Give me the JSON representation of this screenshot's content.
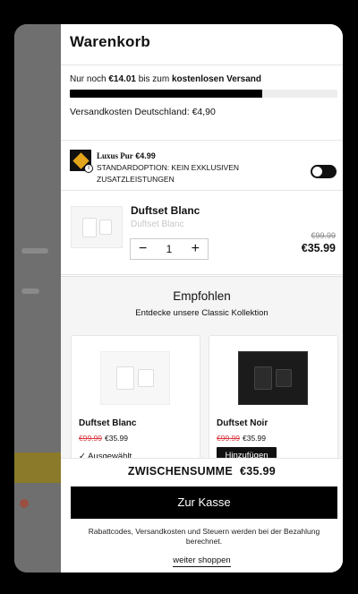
{
  "cart": {
    "title": "Warenkorb"
  },
  "shipping": {
    "prefix": "Nur noch ",
    "remaining": "€14.01",
    "middle": " bis zum ",
    "goal": "kostenlosen Versand",
    "progress": 0.72,
    "cost_label": "Versandkosten Deutschland: €4,90"
  },
  "addon": {
    "brand": "Luxus Pur",
    "price": "€4.99",
    "description": "STANDARDOPTION: KEIN EXKLUSIVEN ZUSATZLEISTUNGEN",
    "toggle_on": false
  },
  "item": {
    "name": "Duftset Blanc",
    "variant": "Duftset Blanc",
    "quantity": "1",
    "minus": "−",
    "plus": "+",
    "old_price": "€99.99",
    "price": "€35.99"
  },
  "recommended": {
    "title": "Empfohlen",
    "subtitle": "Entdecke unsere Classic Kollektion",
    "products": [
      {
        "name": "Duftset Blanc",
        "old_price": "€99.99",
        "price": "€35.99",
        "status": "✓ Ausgewählt"
      },
      {
        "name": "Duftset Noir",
        "old_price": "€99.99",
        "price": "€35.99",
        "button": "Hinzufügen"
      }
    ]
  },
  "footer": {
    "subtotal_label": "ZWISCHENSUMME",
    "subtotal_value": "€35.99",
    "checkout": "Zur Kasse",
    "note": "Rabattcodes, Versandkosten und Steuern werden bei der Bezahlung berechnet.",
    "continue": "weiter shoppen"
  },
  "colors": {
    "sale_red": "#d9363e",
    "primary": "#000000",
    "addon_gold": "#e2a51b"
  }
}
